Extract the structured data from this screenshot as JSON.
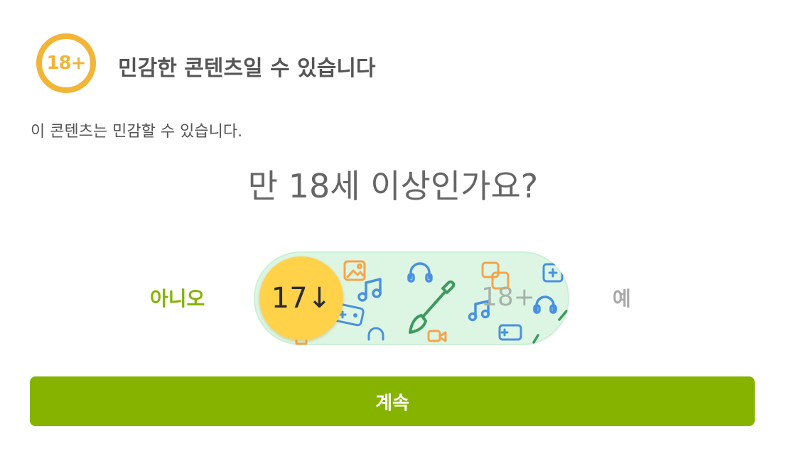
{
  "header": {
    "badge_text": "18+",
    "title": "민감한 콘텐츠일 수 있습니다"
  },
  "description": "이 콘텐츠는 민감할 수 있습니다.",
  "question": "만 18세 이상인가요?",
  "age_selector": {
    "no_label": "아니오",
    "yes_label": "예",
    "thumb_label": "17↓",
    "track_label": "18+",
    "selected": "아니오"
  },
  "continue_button": {
    "label": "계속"
  },
  "colors": {
    "accent_green": "#86B300",
    "badge_yellow": "#F2B535",
    "thumb_yellow": "#FFD24A",
    "track_background": "#DDF6E4"
  },
  "icons": [
    "18-plus-icon",
    "image-icon",
    "headphones-icon",
    "music-note-icon",
    "paintbrush-icon",
    "video-camera-icon",
    "gamepad-icon"
  ]
}
